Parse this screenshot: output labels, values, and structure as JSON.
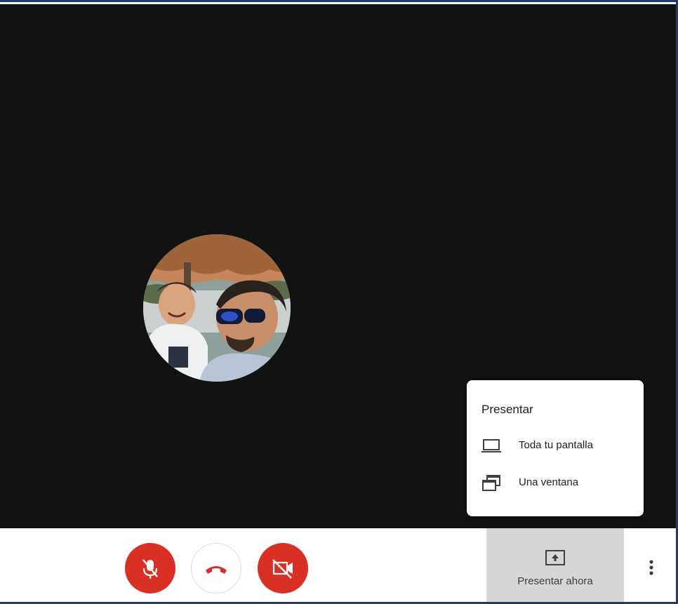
{
  "popup": {
    "title": "Presentar",
    "items": [
      {
        "label": "Toda tu pantalla",
        "icon": "laptop-icon"
      },
      {
        "label": "Una ventana",
        "icon": "window-icon"
      }
    ]
  },
  "toolbar": {
    "mic_icon": "mic-off-icon",
    "hangup_icon": "phone-hangup-icon",
    "camera_icon": "camera-off-icon",
    "present_label": "Presentar ahora",
    "present_icon": "present-screen-icon",
    "more_icon": "more-vertical-icon"
  },
  "colors": {
    "stage": "#121212",
    "danger": "#d93025",
    "present_bg": "#d6d6d6",
    "frame": "#1f3a6b"
  }
}
